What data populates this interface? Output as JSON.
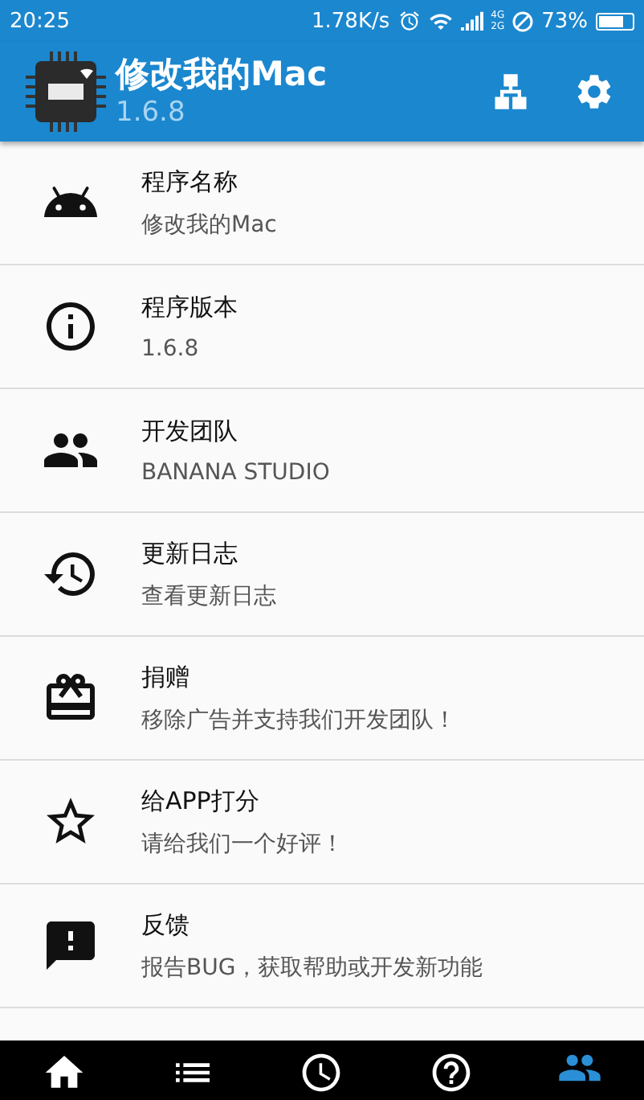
{
  "status_bar": {
    "time": "20:25",
    "speed": "1.78K/s",
    "network_top": "4G",
    "network_bottom": "2G",
    "battery": "73%"
  },
  "app_bar": {
    "title": "修改我的Mac",
    "subtitle": "1.6.8"
  },
  "items": [
    {
      "kind": "android",
      "title": "程序名称",
      "subtitle": "修改我的Mac"
    },
    {
      "kind": "info",
      "title": "程序版本",
      "subtitle": "1.6.8"
    },
    {
      "kind": "team",
      "title": "开发团队",
      "subtitle": "BANANA STUDIO"
    },
    {
      "kind": "history",
      "title": "更新日志",
      "subtitle": "查看更新日志"
    },
    {
      "kind": "gift",
      "title": "捐赠",
      "subtitle": "移除广告并支持我们开发团队！"
    },
    {
      "kind": "star",
      "title": "给APP打分",
      "subtitle": "请给我们一个好评！"
    },
    {
      "kind": "feedback",
      "title": "反馈",
      "subtitle": "报告BUG，获取帮助或开发新功能"
    }
  ],
  "bottom_nav": [
    {
      "kind": "home",
      "selected": false
    },
    {
      "kind": "list",
      "selected": false
    },
    {
      "kind": "clock",
      "selected": false
    },
    {
      "kind": "help",
      "selected": false
    },
    {
      "kind": "team",
      "selected": true
    }
  ]
}
